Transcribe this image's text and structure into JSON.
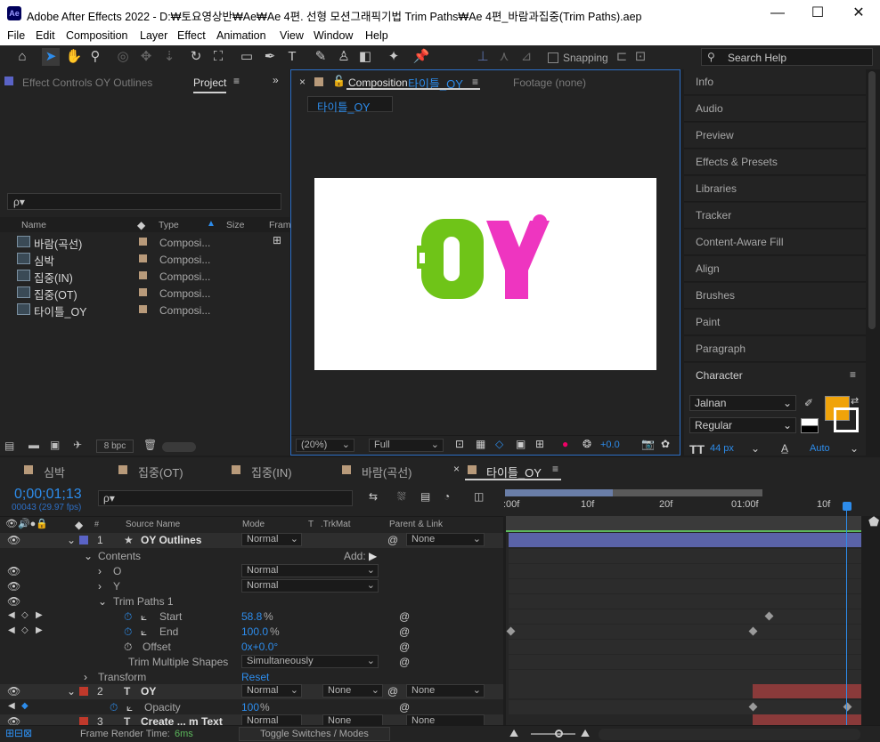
{
  "window": {
    "title": "Adobe After Effects 2022 - D:₩토요영상반₩Ae₩Ae 4편. 선형 모션그래픽기법 Trim Paths₩Ae 4편_바람과집중(Trim Paths).aep",
    "logo": "Ae"
  },
  "menu": [
    "File",
    "Edit",
    "Composition",
    "Layer",
    "Effect",
    "Animation",
    "View",
    "Window",
    "Help"
  ],
  "toolbar": {
    "snapping": "Snapping",
    "search_help": "Search Help"
  },
  "left_panel": {
    "tab_effect_controls": "Effect Controls OY Outlines",
    "tab_project": "Project",
    "search_placeholder": "ρ▾",
    "columns": {
      "name": "Name",
      "type": "Type",
      "size": "Size",
      "frame": "Fram"
    },
    "items": [
      {
        "name": "바람(곡선)",
        "type": "Composi..."
      },
      {
        "name": "심박",
        "type": "Composi..."
      },
      {
        "name": "집중(IN)",
        "type": "Composi..."
      },
      {
        "name": "집중(OT)",
        "type": "Composi..."
      },
      {
        "name": "타이틀_OY",
        "type": "Composi..."
      }
    ],
    "bpc": "8 bpc"
  },
  "viewer": {
    "tab_prefix": "Composition",
    "comp_name": "타이틀_OY",
    "footage": "Footage  (none)",
    "sub_tab": "타이틀_OY",
    "zoom": "(20%)",
    "quality": "Full",
    "exposure": "+0.0",
    "canvas_text_o": "O",
    "canvas_text_y": "Y",
    "colors": {
      "o": "#6fc418",
      "y": "#ee35c0"
    }
  },
  "right_panel": {
    "items": [
      "Info",
      "Audio",
      "Preview",
      "Effects & Presets",
      "Libraries",
      "Tracker",
      "Content-Aware Fill",
      "Align",
      "Brushes",
      "Paint",
      "Paragraph",
      "Character"
    ],
    "font": "Jalnan",
    "style": "Regular",
    "size": "44 px",
    "leading": "Auto",
    "fill_color": "#f0a30a"
  },
  "timeline": {
    "tabs": [
      "심박",
      "집중(OT)",
      "집중(IN)",
      "바람(곡선)",
      "타이틀_OY"
    ],
    "timecode": "0;00;01;13",
    "frame_info": "00043 (29.97 fps)",
    "col_headers": {
      "source": "Source Name",
      "mode": "Mode",
      "t": "T",
      "trkmat": ".TrkMat",
      "parent": "Parent & Link"
    },
    "ruler": [
      ":00f",
      "10f",
      "20f",
      "01:00f",
      "10f"
    ],
    "layer1": {
      "num": "1",
      "name": "OY Outlines",
      "mode": "Normal",
      "parent": "None"
    },
    "contents": "Contents",
    "add": "Add:",
    "o_label": "O",
    "o_mode": "Normal",
    "y_label": "Y",
    "y_mode": "Normal",
    "trim": "Trim Paths 1",
    "start_label": "Start",
    "start_val": "58.8",
    "end_label": "End",
    "end_val": "100.0",
    "pct": "%",
    "offset_label": "Offset",
    "offset_val": "0x+0.0°",
    "tms_label": "Trim Multiple Shapes",
    "tms_val": "Simultaneously",
    "transform": "Transform",
    "reset": "Reset",
    "layer2": {
      "num": "2",
      "name": "OY",
      "mode": "Normal",
      "trkmat": "None",
      "parent": "None"
    },
    "opacity_label": "Opacity",
    "opacity_val": "100",
    "layer3": {
      "num": "3",
      "name": "Create ... m Text",
      "mode": "Normal",
      "trkmat": "None",
      "parent": "None"
    },
    "render_label": "Frame Render Time:",
    "render_val": "6ms",
    "toggle": "Toggle Switches / Modes"
  }
}
